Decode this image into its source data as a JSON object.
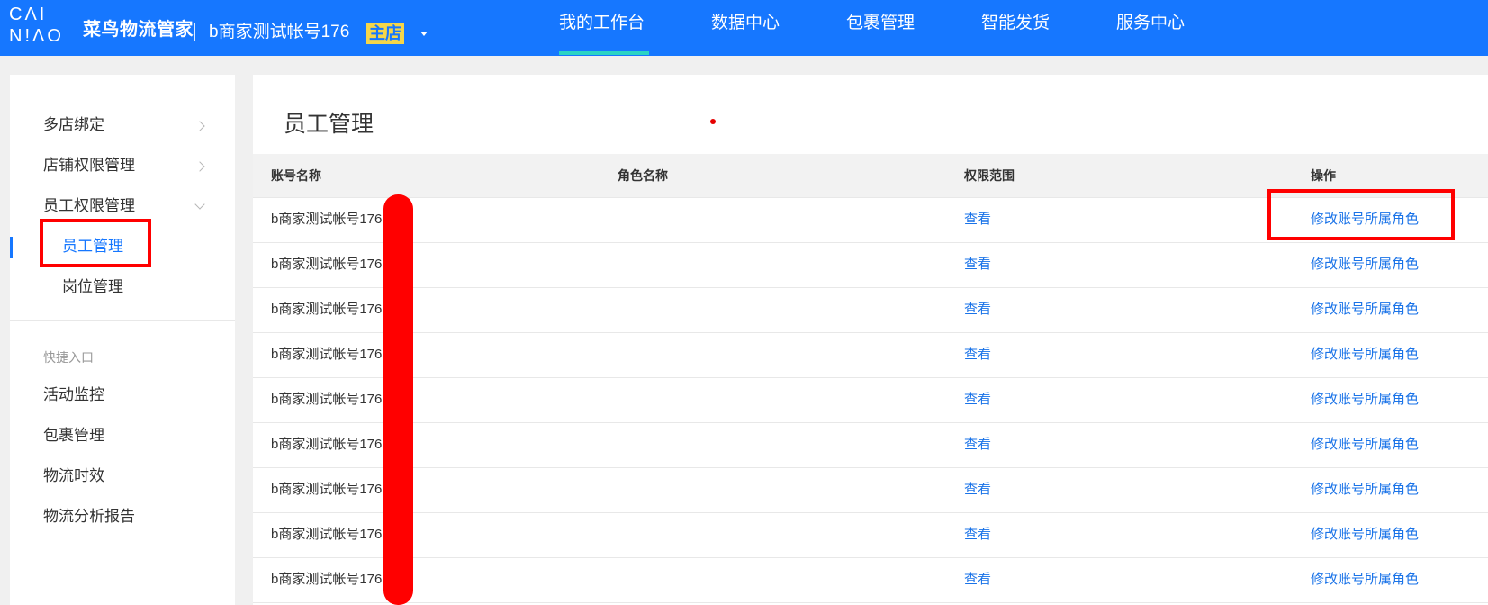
{
  "header": {
    "logo_en_line1": "CɅI",
    "logo_en_line2": "N!ɅO",
    "logo_cn": "菜鸟物流管家",
    "account_name": "b商家测试帐号176",
    "account_badge": "主店",
    "nav": [
      {
        "label": "我的工作台",
        "active": true
      },
      {
        "label": "数据中心"
      },
      {
        "label": "包裹管理"
      },
      {
        "label": "智能发货"
      },
      {
        "label": "服务中心"
      }
    ]
  },
  "sidebar": {
    "items": [
      {
        "label": "多店绑定"
      },
      {
        "label": "店铺权限管理"
      },
      {
        "label": "员工权限管理",
        "expanded": true
      }
    ],
    "sub_items": [
      {
        "label": "员工管理",
        "active": true
      },
      {
        "label": "岗位管理"
      }
    ],
    "quick_section_label": "快捷入口",
    "quick_items": [
      {
        "label": "活动监控"
      },
      {
        "label": "包裹管理"
      },
      {
        "label": "物流时效"
      },
      {
        "label": "物流分析报告"
      }
    ]
  },
  "main": {
    "title": "员工管理",
    "table": {
      "columns": [
        "账号名称",
        "角色名称",
        "权限范围",
        "操作"
      ],
      "rows": [
        {
          "account": "b商家测试帐号176:",
          "role": "",
          "scope_action": "查看",
          "operation": "修改账号所属角色"
        },
        {
          "account": "b商家测试帐号176:",
          "role": "",
          "scope_action": "查看",
          "operation": "修改账号所属角色"
        },
        {
          "account": "b商家测试帐号176:",
          "role": "",
          "scope_action": "查看",
          "operation": "修改账号所属角色"
        },
        {
          "account": "b商家测试帐号176:",
          "role": "",
          "scope_action": "查看",
          "operation": "修改账号所属角色"
        },
        {
          "account": "b商家测试帐号176:",
          "role": "",
          "scope_action": "查看",
          "operation": "修改账号所属角色"
        },
        {
          "account": "b商家测试帐号176:",
          "role": "",
          "scope_action": "查看",
          "operation": "修改账号所属角色"
        },
        {
          "account": "b商家测试帐号176:",
          "role": "",
          "scope_action": "查看",
          "operation": "修改账号所属角色"
        },
        {
          "account": "b商家测试帐号176:",
          "role": "",
          "scope_action": "查看",
          "operation": "修改账号所属角色"
        },
        {
          "account": "b商家测试帐号176:",
          "role": "",
          "scope_action": "查看",
          "operation": "修改账号所属角色"
        }
      ]
    }
  },
  "colors": {
    "brand_blue": "#1677ff",
    "nav_active_underline": "#2ad4c4",
    "badge_yellow": "#f5d64a",
    "link_blue": "#1a73e8",
    "annotation_red": "#ff0000"
  },
  "icons": {
    "account_dropdown": "caret-down-icon",
    "collapsed_menu": "chevron-right-icon",
    "expanded_menu": "chevron-down-icon"
  }
}
